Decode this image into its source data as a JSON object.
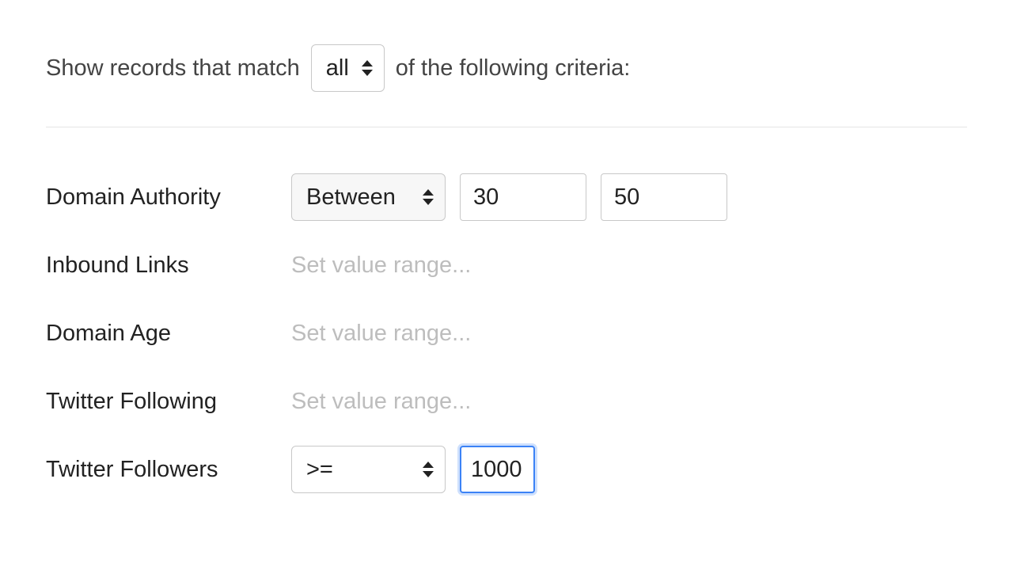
{
  "header": {
    "prefix": "Show records that match",
    "match_mode": "all",
    "suffix": "of the following criteria:"
  },
  "criteria": {
    "domain_authority": {
      "label": "Domain Authority",
      "operator": "Between",
      "value_low": "30",
      "value_high": "50"
    },
    "inbound_links": {
      "label": "Inbound Links",
      "placeholder": "Set value range..."
    },
    "domain_age": {
      "label": "Domain Age",
      "placeholder": "Set value range..."
    },
    "twitter_following": {
      "label": "Twitter Following",
      "placeholder": "Set value range..."
    },
    "twitter_followers": {
      "label": "Twitter Followers",
      "operator": ">=",
      "value": "1000"
    }
  }
}
